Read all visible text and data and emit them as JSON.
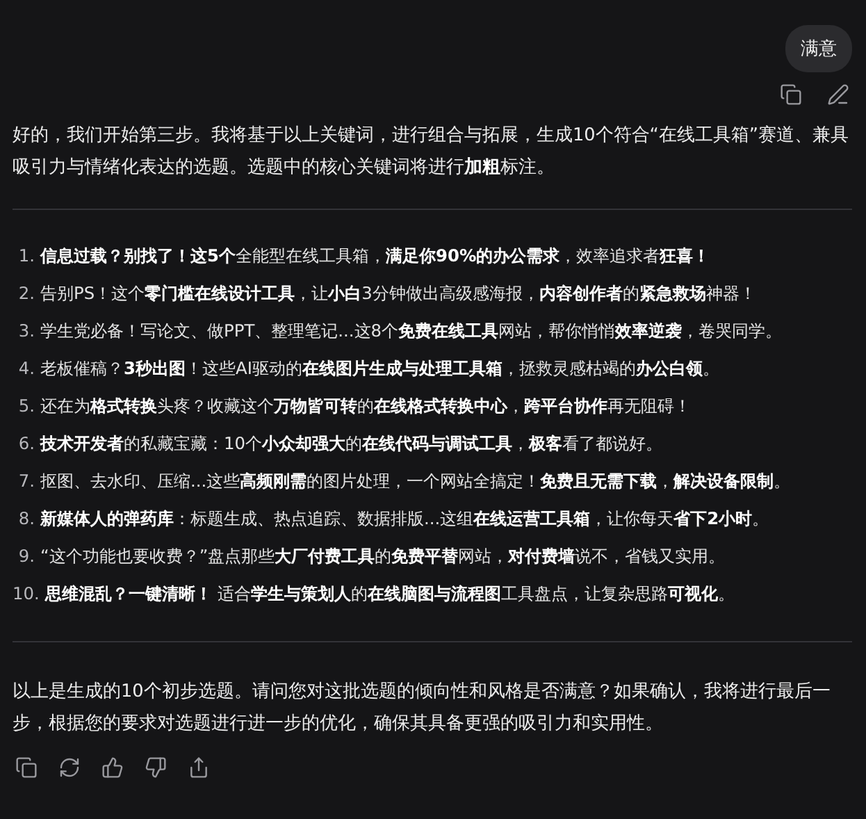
{
  "user_message": {
    "text": "满意"
  },
  "assistant": {
    "intro": "好的，我们开始第三步。我将基于以上关键词，进行组合与拓展，生成10个符合“在线工具箱”赛道、兼具吸引力与情绪化表达的选题。选题中的核心关键词将进行**加粗**标注。",
    "topics": [
      {
        "number": "1.",
        "text": "**信息过载？别找了！这5个**全能型在线工具箱，**满足你90%的办公需求**，效率追求者**狂喜！**"
      },
      {
        "number": "2.",
        "text": "告别PS！这个**零门槛在线设计工具**，让**小白**3分钟做出高级感海报，**内容创作者**的**紧急救场**神器！"
      },
      {
        "number": "3.",
        "text": "学生党必备！写论文、做PPT、整理笔记...这8个**免费在线工具**网站，帮你悄悄**效率逆袭**，卷哭同学。"
      },
      {
        "number": "4.",
        "text": "老板催稿？**3秒出图**！这些AI驱动的**在线图片生成与处理工具箱**，拯救灵感枯竭的**办公白领**。"
      },
      {
        "number": "5.",
        "text": "还在为**格式转换**头疼？收藏这个**万物皆可转**的**在线格式转换中心**，**跨平台协作**再无阻碍！"
      },
      {
        "number": "6.",
        "text": "**技术开发者**的私藏宝藏：10个**小众却强大**的**在线代码与调试工具**，**极客**看了都说好。"
      },
      {
        "number": "7.",
        "text": "抠图、去水印、压缩...这些**高频刚需**的图片处理，一个网站全搞定！**免费且无需下载**，**解决设备限制**。"
      },
      {
        "number": "8.",
        "text": "**新媒体人的弹药库**：标题生成、热点追踪、数据排版...这组**在线运营工具箱**，让你每天**省下2小时**。"
      },
      {
        "number": "9.",
        "text": "“这个功能也要收费？”盘点那些**大厂付费工具**的**免费平替**网站，**对付费墙**说不，省钱又实用。"
      },
      {
        "number": "10.",
        "text": "**思维混乱？一键清晰！** 适合**学生与策划人**的**在线脑图与流程图**工具盘点，让复杂思路**可视化**。"
      }
    ],
    "closing": "以上是生成的10个初步选题。请问您对这批选题的倾向性和风格是否满意？如果确认，我将进行最后一步，根据您的要求对选题进行进一步的优化，确保其具备更强的吸引力和实用性。"
  }
}
